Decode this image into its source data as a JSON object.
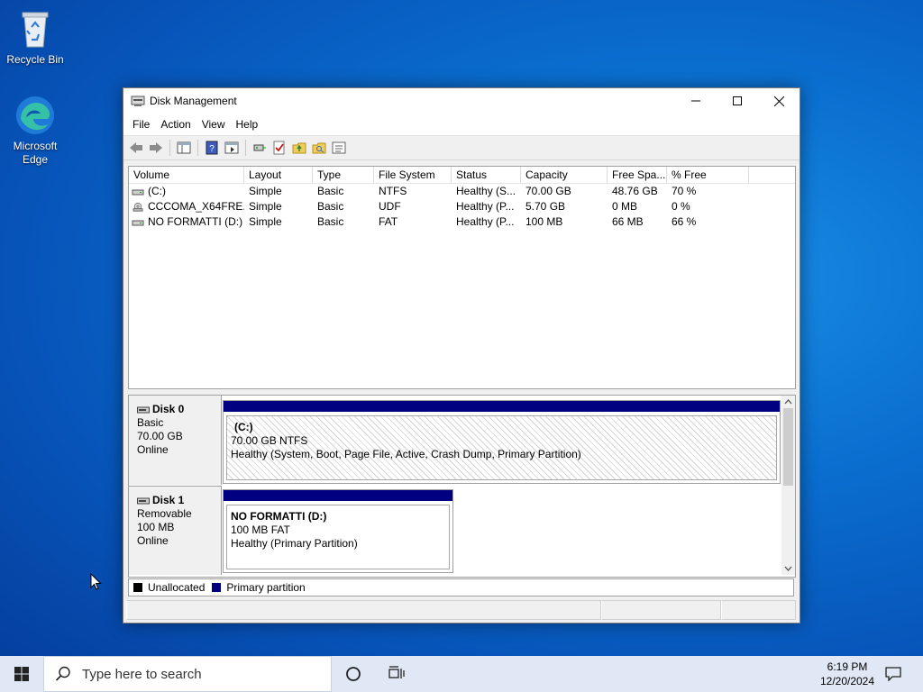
{
  "desktop": {
    "icons": [
      {
        "label": "Recycle Bin"
      },
      {
        "label": "Microsoft Edge"
      }
    ]
  },
  "window": {
    "title": "Disk Management",
    "menu": [
      "File",
      "Action",
      "View",
      "Help"
    ]
  },
  "volume_list": {
    "columns": [
      "Volume",
      "Layout",
      "Type",
      "File System",
      "Status",
      "Capacity",
      "Free Spa...",
      "% Free"
    ],
    "rows": [
      [
        "(C:)",
        "Simple",
        "Basic",
        "NTFS",
        "Healthy (S...",
        "70.00 GB",
        "48.76 GB",
        "70 %"
      ],
      [
        "CCCOMA_X64FRE...",
        "Simple",
        "Basic",
        "UDF",
        "Healthy (P...",
        "5.70 GB",
        "0 MB",
        "0 %"
      ],
      [
        "NO FORMATTI (D:)",
        "Simple",
        "Basic",
        "FAT",
        "Healthy (P...",
        "100 MB",
        "66 MB",
        "66 %"
      ]
    ]
  },
  "disks": [
    {
      "name": "Disk 0",
      "kind": "Basic",
      "size": "70.00 GB",
      "state": "Online",
      "partition": {
        "label": "(C:)",
        "size_fs": "70.00 GB NTFS",
        "status": "Healthy (System, Boot, Page File, Active, Crash Dump, Primary Partition)"
      }
    },
    {
      "name": "Disk 1",
      "kind": "Removable",
      "size": "100 MB",
      "state": "Online",
      "partition": {
        "label": "NO FORMATTI  (D:)",
        "size_fs": "100 MB FAT",
        "status": "Healthy (Primary Partition)"
      }
    }
  ],
  "legend": {
    "items": [
      {
        "label": "Unallocated",
        "color": "#000000"
      },
      {
        "label": "Primary partition",
        "color": "#000080"
      }
    ]
  },
  "taskbar": {
    "search_placeholder": "Type here to search",
    "time": "6:19 PM",
    "date": "12/20/2024"
  },
  "colors": {
    "primary_partition": "#000080",
    "unallocated": "#000000"
  }
}
